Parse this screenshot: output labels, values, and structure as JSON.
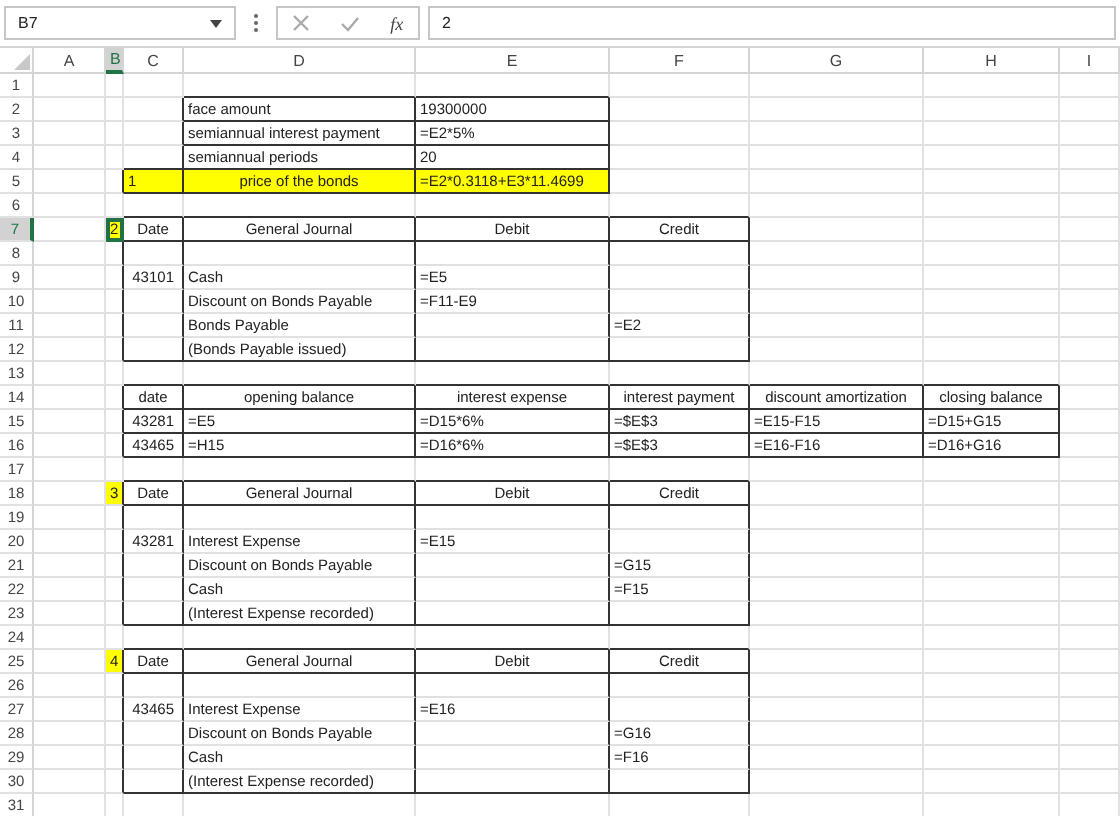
{
  "formula_bar": {
    "name_box": "B7",
    "function_label": "fx",
    "formula": "2"
  },
  "columns": [
    {
      "label": "A",
      "selected": false
    },
    {
      "label": "B",
      "selected": true
    },
    {
      "label": "C",
      "selected": false
    },
    {
      "label": "D",
      "selected": false
    },
    {
      "label": "E",
      "selected": false
    },
    {
      "label": "F",
      "selected": false
    },
    {
      "label": "G",
      "selected": false
    },
    {
      "label": "H",
      "selected": false
    },
    {
      "label": "I",
      "selected": false
    }
  ],
  "rows": [
    {
      "number": "1",
      "selected": false
    },
    {
      "number": "2",
      "selected": false,
      "cells": [
        {
          "kind": "plain",
          "highlight": false,
          "selected": false
        },
        {
          "kind": "plain",
          "highlight": false,
          "selected": false
        },
        {
          "kind": "plain",
          "highlight": false,
          "selected": false
        },
        {
          "text": "face amount",
          "kind": "box",
          "centered": false,
          "numeric": false,
          "highlight": false,
          "selected": false
        },
        {
          "text": "19300000",
          "kind": "box",
          "centered": false,
          "numeric": false,
          "highlight": false,
          "selected": false
        }
      ]
    },
    {
      "number": "3",
      "selected": false,
      "cells": [
        {
          "kind": "plain",
          "highlight": false,
          "selected": false
        },
        {
          "kind": "plain",
          "highlight": false,
          "selected": false
        },
        {
          "kind": "plain",
          "highlight": false,
          "selected": false
        },
        {
          "text": "semiannual interest payment",
          "kind": "box",
          "centered": false,
          "numeric": false,
          "highlight": false,
          "selected": false
        },
        {
          "text": "=E2*5%",
          "kind": "box",
          "centered": false,
          "numeric": false,
          "highlight": false,
          "selected": false
        }
      ]
    },
    {
      "number": "4",
      "selected": false,
      "cells": [
        {
          "kind": "plain",
          "highlight": false,
          "selected": false
        },
        {
          "kind": "plain",
          "highlight": false,
          "selected": false
        },
        {
          "kind": "plain",
          "highlight": false,
          "selected": false
        },
        {
          "text": "semiannual periods",
          "kind": "box",
          "centered": false,
          "numeric": false,
          "highlight": false,
          "selected": false
        },
        {
          "text": "20",
          "kind": "box",
          "centered": false,
          "numeric": false,
          "highlight": false,
          "selected": false
        }
      ]
    },
    {
      "number": "5",
      "selected": false,
      "cells": [
        {
          "kind": "plain",
          "highlight": false,
          "selected": false
        },
        {
          "kind": "plain",
          "highlight": false,
          "selected": false
        },
        {
          "text": "1",
          "kind": "box",
          "centered": false,
          "numeric": false,
          "highlight": true,
          "selected": false
        },
        {
          "text": "price of the bonds",
          "kind": "box",
          "centered": true,
          "numeric": false,
          "highlight": true,
          "selected": false
        },
        {
          "text": "=E2*0.3118+E3*11.4699",
          "kind": "box",
          "centered": false,
          "numeric": false,
          "highlight": true,
          "selected": false
        }
      ]
    },
    {
      "number": "6",
      "selected": false
    },
    {
      "number": "7",
      "selected": true,
      "cells": [
        {
          "kind": "plain",
          "highlight": false,
          "selected": false
        },
        {
          "text": "2",
          "kind": "plain",
          "centered": false,
          "numeric": false,
          "highlight": true,
          "selected": true
        },
        {
          "text": "Date",
          "kind": "box",
          "centered": true,
          "numeric": false,
          "highlight": false,
          "selected": false
        },
        {
          "text": "General Journal",
          "kind": "box",
          "centered": true,
          "numeric": false,
          "highlight": false,
          "selected": false
        },
        {
          "text": "Debit",
          "kind": "box",
          "centered": true,
          "numeric": false,
          "highlight": false,
          "selected": false
        },
        {
          "text": "Credit",
          "kind": "box",
          "centered": true,
          "numeric": false,
          "highlight": false,
          "selected": false
        }
      ]
    },
    {
      "number": "8",
      "selected": false,
      "cells": [
        {
          "kind": "plain",
          "highlight": false,
          "selected": false
        },
        {
          "kind": "plain",
          "highlight": false,
          "selected": false
        },
        {
          "kind": "side",
          "highlight": false,
          "selected": false
        },
        {
          "kind": "side",
          "highlight": false,
          "selected": false
        },
        {
          "kind": "side",
          "highlight": false,
          "selected": false
        },
        {
          "kind": "side",
          "highlight": false,
          "selected": false
        }
      ]
    },
    {
      "number": "9",
      "selected": false,
      "cells": [
        {
          "kind": "plain",
          "highlight": false,
          "selected": false
        },
        {
          "kind": "plain",
          "highlight": false,
          "selected": false
        },
        {
          "text": "43101",
          "kind": "side",
          "centered": false,
          "numeric": true,
          "highlight": false,
          "selected": false
        },
        {
          "text": "Cash",
          "kind": "side",
          "centered": false,
          "numeric": false,
          "highlight": false,
          "selected": false
        },
        {
          "text": "=E5",
          "kind": "side",
          "centered": false,
          "numeric": false,
          "highlight": false,
          "selected": false
        },
        {
          "kind": "side",
          "highlight": false,
          "selected": false
        }
      ]
    },
    {
      "number": "10",
      "selected": false,
      "cells": [
        {
          "kind": "plain",
          "highlight": false,
          "selected": false
        },
        {
          "kind": "plain",
          "highlight": false,
          "selected": false
        },
        {
          "kind": "side",
          "highlight": false,
          "selected": false
        },
        {
          "text": "Discount on Bonds Payable",
          "kind": "side",
          "centered": false,
          "numeric": false,
          "highlight": false,
          "selected": false
        },
        {
          "text": "=F11-E9",
          "kind": "side",
          "centered": false,
          "numeric": false,
          "highlight": false,
          "selected": false
        },
        {
          "kind": "side",
          "highlight": false,
          "selected": false
        }
      ]
    },
    {
      "number": "11",
      "selected": false,
      "cells": [
        {
          "kind": "plain",
          "highlight": false,
          "selected": false
        },
        {
          "kind": "plain",
          "highlight": false,
          "selected": false
        },
        {
          "kind": "side",
          "highlight": false,
          "selected": false
        },
        {
          "text": "Bonds Payable",
          "kind": "side",
          "centered": false,
          "numeric": false,
          "highlight": false,
          "selected": false
        },
        {
          "kind": "side",
          "highlight": false,
          "selected": false
        },
        {
          "text": "=E2",
          "kind": "side",
          "centered": false,
          "numeric": false,
          "highlight": false,
          "selected": false
        }
      ]
    },
    {
      "number": "12",
      "selected": false,
      "cells": [
        {
          "kind": "plain",
          "highlight": false,
          "selected": false
        },
        {
          "kind": "plain",
          "highlight": false,
          "selected": false
        },
        {
          "kind": "base",
          "highlight": false,
          "selected": false
        },
        {
          "text": "(Bonds Payable issued)",
          "kind": "base",
          "centered": false,
          "numeric": false,
          "highlight": false,
          "selected": false
        },
        {
          "kind": "base",
          "highlight": false,
          "selected": false
        },
        {
          "kind": "base",
          "highlight": false,
          "selected": false
        }
      ]
    },
    {
      "number": "13",
      "selected": false
    },
    {
      "number": "14",
      "selected": false,
      "cells": [
        {
          "kind": "plain",
          "highlight": false,
          "selected": false
        },
        {
          "kind": "plain",
          "highlight": false,
          "selected": false
        },
        {
          "text": "date",
          "kind": "box",
          "centered": true,
          "numeric": false,
          "highlight": false,
          "selected": false
        },
        {
          "text": "opening balance",
          "kind": "box",
          "centered": true,
          "numeric": false,
          "highlight": false,
          "selected": false
        },
        {
          "text": "interest expense",
          "kind": "box",
          "centered": true,
          "numeric": false,
          "highlight": false,
          "selected": false
        },
        {
          "text": "interest payment",
          "kind": "box",
          "centered": true,
          "numeric": false,
          "highlight": false,
          "selected": false
        },
        {
          "text": "discount amortization",
          "kind": "box",
          "centered": true,
          "numeric": false,
          "highlight": false,
          "selected": false
        },
        {
          "text": "closing balance",
          "kind": "box",
          "centered": true,
          "numeric": false,
          "highlight": false,
          "selected": false
        }
      ]
    },
    {
      "number": "15",
      "selected": false,
      "cells": [
        {
          "kind": "plain",
          "highlight": false,
          "selected": false
        },
        {
          "kind": "plain",
          "highlight": false,
          "selected": false
        },
        {
          "text": "43281",
          "kind": "box",
          "centered": false,
          "numeric": true,
          "highlight": false,
          "selected": false
        },
        {
          "text": "=E5",
          "kind": "box",
          "centered": false,
          "numeric": false,
          "highlight": false,
          "selected": false
        },
        {
          "text": "=D15*6%",
          "kind": "box",
          "centered": false,
          "numeric": false,
          "highlight": false,
          "selected": false
        },
        {
          "text": "=$E$3",
          "kind": "box",
          "centered": false,
          "numeric": false,
          "highlight": false,
          "selected": false
        },
        {
          "text": "=E15-F15",
          "kind": "box",
          "centered": false,
          "numeric": false,
          "highlight": false,
          "selected": false
        },
        {
          "text": "=D15+G15",
          "kind": "box",
          "centered": false,
          "numeric": false,
          "highlight": false,
          "selected": false
        }
      ]
    },
    {
      "number": "16",
      "selected": false,
      "cells": [
        {
          "kind": "plain",
          "highlight": false,
          "selected": false
        },
        {
          "kind": "plain",
          "highlight": false,
          "selected": false
        },
        {
          "text": "43465",
          "kind": "box",
          "centered": false,
          "numeric": true,
          "highlight": false,
          "selected": false
        },
        {
          "text": "=H15",
          "kind": "box",
          "centered": false,
          "numeric": false,
          "highlight": false,
          "selected": false
        },
        {
          "text": "=D16*6%",
          "kind": "box",
          "centered": false,
          "numeric": false,
          "highlight": false,
          "selected": false
        },
        {
          "text": "=$E$3",
          "kind": "box",
          "centered": false,
          "numeric": false,
          "highlight": false,
          "selected": false
        },
        {
          "text": "=E16-F16",
          "kind": "box",
          "centered": false,
          "numeric": false,
          "highlight": false,
          "selected": false
        },
        {
          "text": "=D16+G16",
          "kind": "box",
          "centered": false,
          "numeric": false,
          "highlight": false,
          "selected": false
        }
      ]
    },
    {
      "number": "17",
      "selected": false
    },
    {
      "number": "18",
      "selected": false,
      "cells": [
        {
          "kind": "plain",
          "highlight": false,
          "selected": false
        },
        {
          "text": "3",
          "kind": "plain",
          "centered": false,
          "numeric": false,
          "highlight": true,
          "selected": false
        },
        {
          "text": "Date",
          "kind": "box",
          "centered": true,
          "numeric": false,
          "highlight": false,
          "selected": false
        },
        {
          "text": "General Journal",
          "kind": "box",
          "centered": true,
          "numeric": false,
          "highlight": false,
          "selected": false
        },
        {
          "text": "Debit",
          "kind": "box",
          "centered": true,
          "numeric": false,
          "highlight": false,
          "selected": false
        },
        {
          "text": "Credit",
          "kind": "box",
          "centered": true,
          "numeric": false,
          "highlight": false,
          "selected": false
        }
      ]
    },
    {
      "number": "19",
      "selected": false,
      "cells": [
        {
          "kind": "plain",
          "highlight": false,
          "selected": false
        },
        {
          "kind": "plain",
          "highlight": false,
          "selected": false
        },
        {
          "kind": "side",
          "highlight": false,
          "selected": false
        },
        {
          "kind": "side",
          "highlight": false,
          "selected": false
        },
        {
          "kind": "side",
          "highlight": false,
          "selected": false
        },
        {
          "kind": "side",
          "highlight": false,
          "selected": false
        }
      ]
    },
    {
      "number": "20",
      "selected": false,
      "cells": [
        {
          "kind": "plain",
          "highlight": false,
          "selected": false
        },
        {
          "kind": "plain",
          "highlight": false,
          "selected": false
        },
        {
          "text": "43281",
          "kind": "side",
          "centered": false,
          "numeric": true,
          "highlight": false,
          "selected": false
        },
        {
          "text": "Interest Expense",
          "kind": "side",
          "centered": false,
          "numeric": false,
          "highlight": false,
          "selected": false
        },
        {
          "text": "=E15",
          "kind": "side",
          "centered": false,
          "numeric": false,
          "highlight": false,
          "selected": false
        },
        {
          "kind": "side",
          "highlight": false,
          "selected": false
        }
      ]
    },
    {
      "number": "21",
      "selected": false,
      "cells": [
        {
          "kind": "plain",
          "highlight": false,
          "selected": false
        },
        {
          "kind": "plain",
          "highlight": false,
          "selected": false
        },
        {
          "kind": "side",
          "highlight": false,
          "selected": false
        },
        {
          "text": "Discount on Bonds Payable",
          "kind": "side",
          "centered": false,
          "numeric": false,
          "highlight": false,
          "selected": false
        },
        {
          "kind": "side",
          "highlight": false,
          "selected": false
        },
        {
          "text": "=G15",
          "kind": "side",
          "centered": false,
          "numeric": false,
          "highlight": false,
          "selected": false
        }
      ]
    },
    {
      "number": "22",
      "selected": false,
      "cells": [
        {
          "kind": "plain",
          "highlight": false,
          "selected": false
        },
        {
          "kind": "plain",
          "highlight": false,
          "selected": false
        },
        {
          "kind": "side",
          "highlight": false,
          "selected": false
        },
        {
          "text": "Cash",
          "kind": "side",
          "centered": false,
          "numeric": false,
          "highlight": false,
          "selected": false
        },
        {
          "kind": "side",
          "highlight": false,
          "selected": false
        },
        {
          "text": "=F15",
          "kind": "side",
          "centered": false,
          "numeric": false,
          "highlight": false,
          "selected": false
        }
      ]
    },
    {
      "number": "23",
      "selected": false,
      "cells": [
        {
          "kind": "plain",
          "highlight": false,
          "selected": false
        },
        {
          "kind": "plain",
          "highlight": false,
          "selected": false
        },
        {
          "kind": "base",
          "highlight": false,
          "selected": false
        },
        {
          "text": "(Interest Expense recorded)",
          "kind": "base",
          "centered": false,
          "numeric": false,
          "highlight": false,
          "selected": false
        },
        {
          "kind": "base",
          "highlight": false,
          "selected": false
        },
        {
          "kind": "base",
          "highlight": false,
          "selected": false
        }
      ]
    },
    {
      "number": "24",
      "selected": false
    },
    {
      "number": "25",
      "selected": false,
      "cells": [
        {
          "kind": "plain",
          "highlight": false,
          "selected": false
        },
        {
          "text": "4",
          "kind": "plain",
          "centered": false,
          "numeric": false,
          "highlight": true,
          "selected": false
        },
        {
          "text": "Date",
          "kind": "box",
          "centered": true,
          "numeric": false,
          "highlight": false,
          "selected": false
        },
        {
          "text": "General Journal",
          "kind": "box",
          "centered": true,
          "numeric": false,
          "highlight": false,
          "selected": false
        },
        {
          "text": "Debit",
          "kind": "box",
          "centered": true,
          "numeric": false,
          "highlight": false,
          "selected": false
        },
        {
          "text": "Credit",
          "kind": "box",
          "centered": true,
          "numeric": false,
          "highlight": false,
          "selected": false
        }
      ]
    },
    {
      "number": "26",
      "selected": false,
      "cells": [
        {
          "kind": "plain",
          "highlight": false,
          "selected": false
        },
        {
          "kind": "plain",
          "highlight": false,
          "selected": false
        },
        {
          "kind": "side",
          "highlight": false,
          "selected": false
        },
        {
          "kind": "side",
          "highlight": false,
          "selected": false
        },
        {
          "kind": "side",
          "highlight": false,
          "selected": false
        },
        {
          "kind": "side",
          "highlight": false,
          "selected": false
        }
      ]
    },
    {
      "number": "27",
      "selected": false,
      "cells": [
        {
          "kind": "plain",
          "highlight": false,
          "selected": false
        },
        {
          "kind": "plain",
          "highlight": false,
          "selected": false
        },
        {
          "text": "43465",
          "kind": "side",
          "centered": false,
          "numeric": true,
          "highlight": false,
          "selected": false
        },
        {
          "text": "Interest Expense",
          "kind": "side",
          "centered": false,
          "numeric": false,
          "highlight": false,
          "selected": false
        },
        {
          "text": "=E16",
          "kind": "side",
          "centered": false,
          "numeric": false,
          "highlight": false,
          "selected": false
        },
        {
          "kind": "side",
          "highlight": false,
          "selected": false
        }
      ]
    },
    {
      "number": "28",
      "selected": false,
      "cells": [
        {
          "kind": "plain",
          "highlight": false,
          "selected": false
        },
        {
          "kind": "plain",
          "highlight": false,
          "selected": false
        },
        {
          "kind": "side",
          "highlight": false,
          "selected": false
        },
        {
          "text": "Discount on Bonds Payable",
          "kind": "side",
          "centered": false,
          "numeric": false,
          "highlight": false,
          "selected": false
        },
        {
          "kind": "side",
          "highlight": false,
          "selected": false
        },
        {
          "text": "=G16",
          "kind": "side",
          "centered": false,
          "numeric": false,
          "highlight": false,
          "selected": false
        }
      ]
    },
    {
      "number": "29",
      "selected": false,
      "cells": [
        {
          "kind": "plain",
          "highlight": false,
          "selected": false
        },
        {
          "kind": "plain",
          "highlight": false,
          "selected": false
        },
        {
          "kind": "side",
          "highlight": false,
          "selected": false
        },
        {
          "text": "Cash",
          "kind": "side",
          "centered": false,
          "numeric": false,
          "highlight": false,
          "selected": false
        },
        {
          "kind": "side",
          "highlight": false,
          "selected": false
        },
        {
          "text": "=F16",
          "kind": "side",
          "centered": false,
          "numeric": false,
          "highlight": false,
          "selected": false
        }
      ]
    },
    {
      "number": "30",
      "selected": false,
      "cells": [
        {
          "kind": "plain",
          "highlight": false,
          "selected": false
        },
        {
          "kind": "plain",
          "highlight": false,
          "selected": false
        },
        {
          "kind": "base",
          "highlight": false,
          "selected": false
        },
        {
          "text": "(Interest Expense recorded)",
          "kind": "base",
          "centered": false,
          "numeric": false,
          "highlight": false,
          "selected": false
        },
        {
          "kind": "base",
          "highlight": false,
          "selected": false
        },
        {
          "kind": "base",
          "highlight": false,
          "selected": false
        }
      ]
    },
    {
      "number": "31",
      "selected": false
    }
  ]
}
